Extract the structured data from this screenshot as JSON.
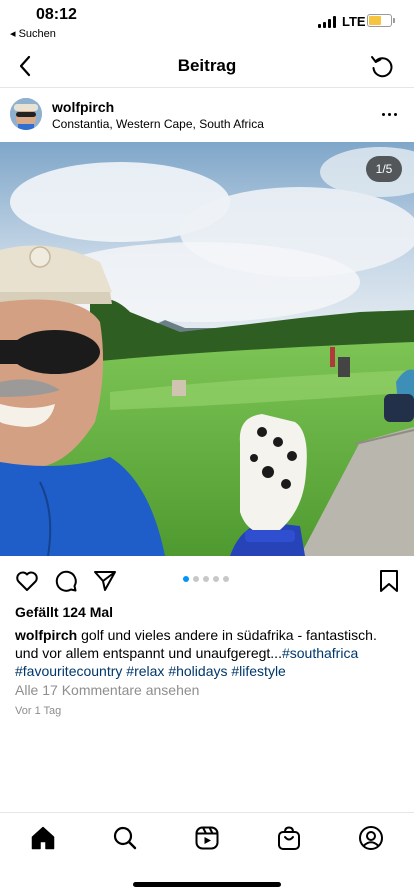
{
  "status_bar": {
    "time": "08:12",
    "back_label": "◂ Suchen",
    "network": "LTE"
  },
  "nav": {
    "title": "Beitrag"
  },
  "post": {
    "username": "wolfpirch",
    "location": "Constantia, Western Cape, South Africa",
    "image_counter": "1/5",
    "likes": "Gefällt 124 Mal",
    "caption_user": "wolfpirch",
    "caption_text": " golf und vieles andere in südafrika - fantastisch. und vor allem entspannt und unaufgeregt...",
    "hashtags": [
      "#southafrica",
      "#favouritecountry",
      "#relax",
      "#holidays",
      "#lifestyle"
    ],
    "view_comments": "Alle 17 Kommentare ansehen",
    "time_ago": "Vor 1 Tag",
    "carousel": {
      "count": 5,
      "active": 0
    }
  },
  "icons": {
    "like": "heart-icon",
    "comment": "comment-icon",
    "share": "send-icon",
    "save": "bookmark-icon",
    "home": "home-icon",
    "search": "search-icon",
    "reels": "reels-icon",
    "shop": "shop-icon",
    "profile": "profile-icon"
  },
  "colors": {
    "accent": "#0095f6",
    "hashtag": "#00376b",
    "muted": "#8e8e8e",
    "battery": "#f7c43f"
  }
}
